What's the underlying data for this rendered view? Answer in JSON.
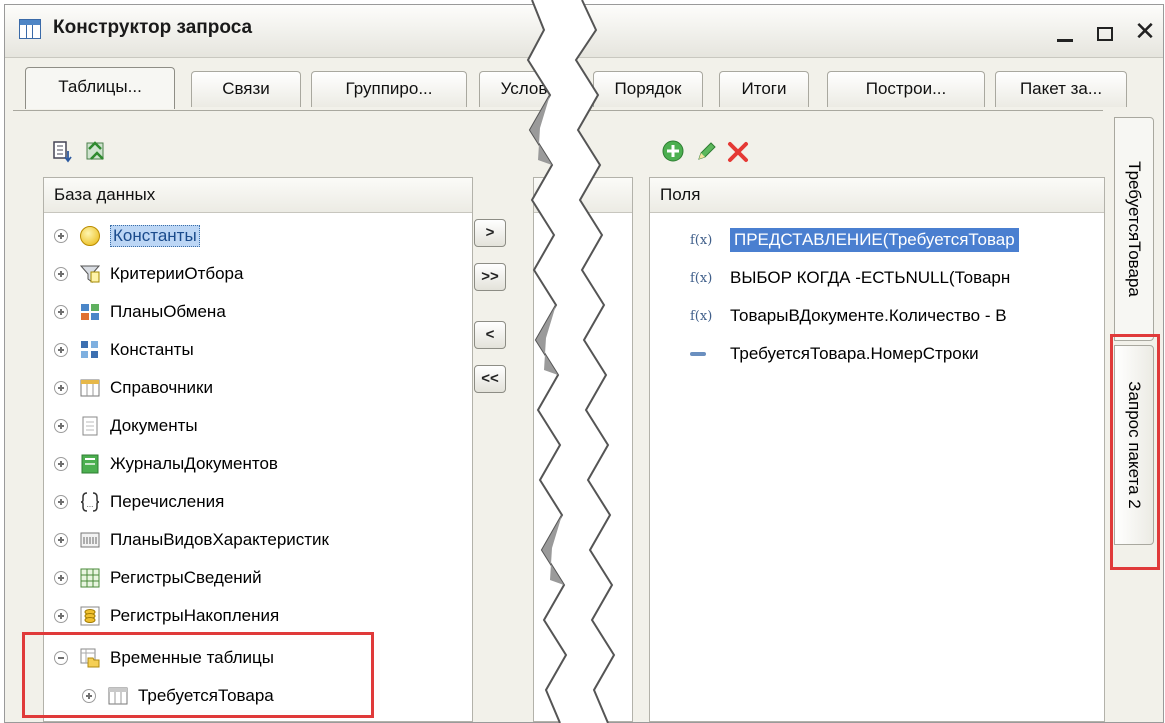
{
  "window": {
    "title": "Конструктор запроса",
    "controls": {
      "minimize": "_",
      "maximize": "□",
      "close": "✕"
    }
  },
  "tabs": [
    "Таблицы...",
    "Связи",
    "Группиро...",
    "Услов",
    "Порядок",
    "Итоги",
    "Построи...",
    "Пакет за..."
  ],
  "left_panel": {
    "header": "База данных",
    "items": [
      "Константы",
      "КритерииОтбора",
      "ПланыОбмена",
      "Константы",
      "Справочники",
      "Документы",
      "ЖурналыДокументов",
      "Перечисления",
      "ПланыВидовХарактеристик",
      "РегистрыСведений",
      "РегистрыНакопления",
      "Временные таблицы",
      "ТребуетсяТовара"
    ]
  },
  "move_buttons": [
    ">",
    ">>",
    "<",
    "<<"
  ],
  "right_panel": {
    "header": "Поля",
    "fields": [
      "ПРЕДСТАВЛЕНИЕ(ТребуетсяТовар",
      "ВЫБОР КОГДА -ЕСТЬNULL(Товарн",
      "ТоварыВДокументе.Количество - В",
      "ТребуетсяТовара.НомерСтроки"
    ],
    "fx_label": "f(x)"
  },
  "side_tabs": [
    "ТребуетсяТовара",
    "Запрос пакета 2"
  ],
  "colors": {
    "highlight": "#e03a3a",
    "selection": "#bcd6f5"
  }
}
